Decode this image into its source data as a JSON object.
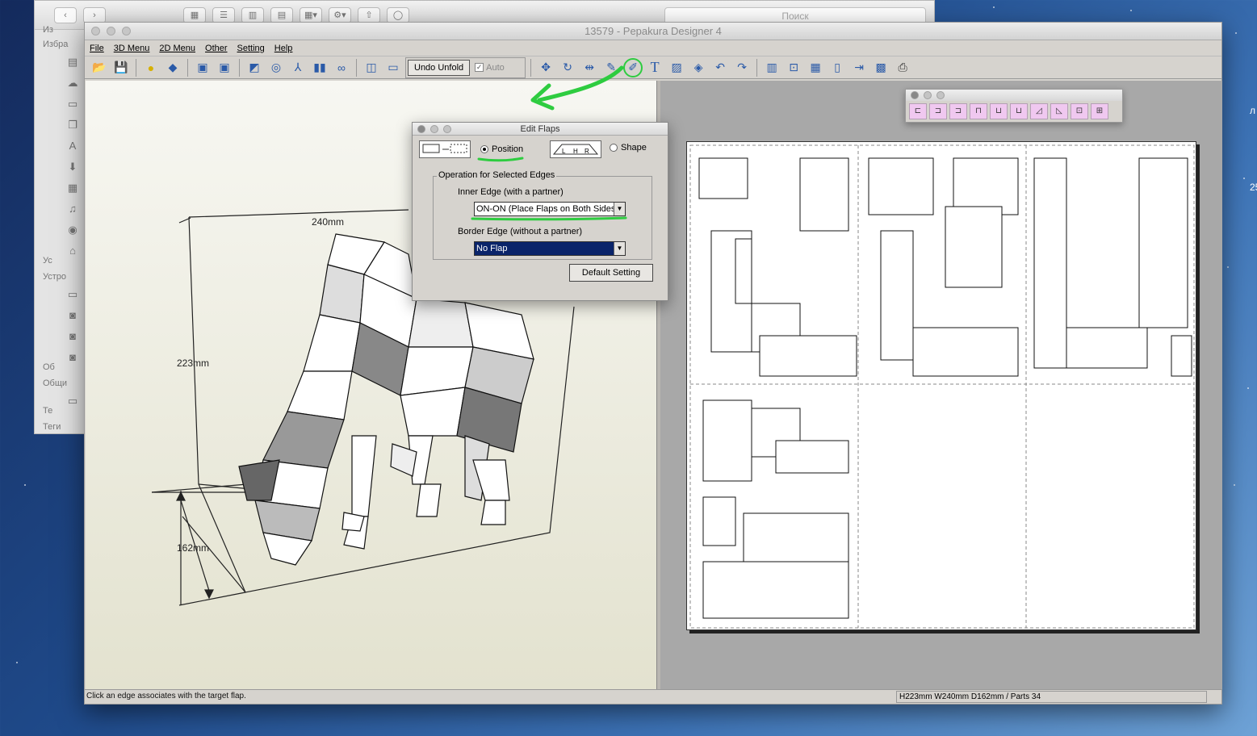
{
  "finder": {
    "search_placeholder": "Поиск",
    "sidebar_labels": [
      "Из",
      "Избра",
      "Ус",
      "Устро",
      "Об",
      "Общи",
      "Те",
      "Теги"
    ]
  },
  "window": {
    "title": "13579 - Pepakura Designer 4"
  },
  "menu": [
    "File",
    "3D Menu",
    "2D Menu",
    "Other",
    "Setting",
    "Help"
  ],
  "toolbar": {
    "undo_unfold": "Undo Unfold",
    "auto_label": "Auto",
    "auto_checked": true
  },
  "view3d": {
    "dim_width": "240mm",
    "dim_height": "223mm",
    "dim_depth": "162mm"
  },
  "edit_flaps": {
    "title": "Edit Flaps",
    "position_label": "Position",
    "shape_label": "Shape",
    "selected": "Position",
    "group_label": "Operation for Selected Edges",
    "inner_label": "Inner Edge (with a partner)",
    "inner_value": "ON-ON (Place Flaps on Both Sides)",
    "border_label": "Border Edge (without a partner)",
    "border_value": "No Flap",
    "default_button": "Default Setting",
    "img_letters": [
      "L",
      "H",
      "R"
    ]
  },
  "status": {
    "left": "Click an edge associates with the target flap.",
    "right": "H223mm W240mm D162mm / Parts 34"
  },
  "desktop_side": [
    "л",
    "25"
  ],
  "colors": {
    "highlight_green": "#2ecc40",
    "selection_blue": "#0a246a"
  }
}
